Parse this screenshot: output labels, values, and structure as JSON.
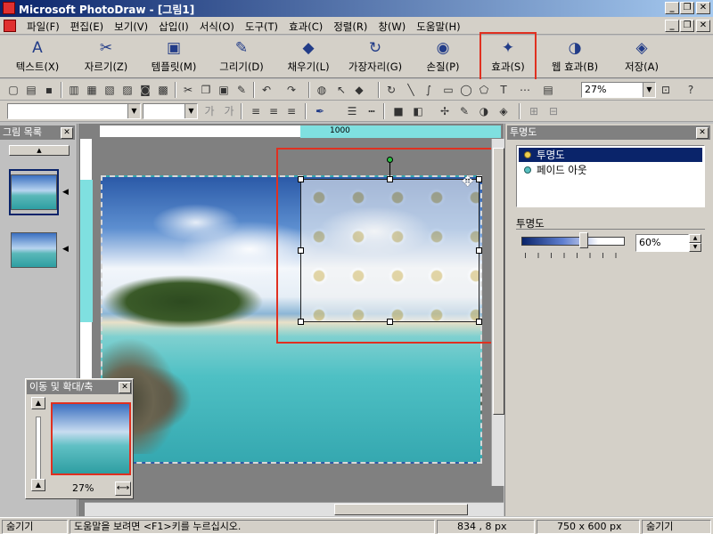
{
  "window": {
    "title": "Microsoft PhotoDraw - [그림1]",
    "min_symbol": "_",
    "max_symbol": "❐",
    "close_symbol": "✕"
  },
  "menu": [
    "파일(F)",
    "편집(E)",
    "보기(V)",
    "삽입(I)",
    "서식(O)",
    "도구(T)",
    "효과(C)",
    "정렬(R)",
    "창(W)",
    "도움말(H)"
  ],
  "bigbar": [
    {
      "label": "텍스트(X)",
      "icon": "A"
    },
    {
      "label": "자르기(Z)",
      "icon": "✂"
    },
    {
      "label": "템플릿(M)",
      "icon": "▣"
    },
    {
      "label": "그리기(D)",
      "icon": "✎"
    },
    {
      "label": "채우기(L)",
      "icon": "◆"
    },
    {
      "label": "가장자리(G)",
      "icon": "↻"
    },
    {
      "label": "손질(P)",
      "icon": "◉"
    },
    {
      "label": "효과(S)",
      "icon": "✦"
    },
    {
      "label": "웹 효과(B)",
      "icon": "◑"
    },
    {
      "label": "저장(A)",
      "icon": "◈"
    }
  ],
  "toolbar": {
    "zoom_value": "27%"
  },
  "left_panel": {
    "title": "그림 목록"
  },
  "ruler": {
    "mark": "1000"
  },
  "pan_zoom": {
    "title": "이동 및 확대/축",
    "zoom": "27%"
  },
  "right_panel": {
    "title": "투명도",
    "effects": [
      {
        "label": "투명도",
        "selected": true,
        "color": "#f0d050"
      },
      {
        "label": "페이드 아웃",
        "selected": false,
        "color": "#58c0c0"
      }
    ],
    "opacity_label": "투명도",
    "opacity_value": "60%",
    "opacity_level": 0.6
  },
  "status": {
    "left_toggle": "숨기기",
    "help": "도움말을 보려면 <F1>키를 누르십시오.",
    "coords": "834 , 8  px",
    "size": "750 x 600  px",
    "right_toggle": "숨기기"
  }
}
